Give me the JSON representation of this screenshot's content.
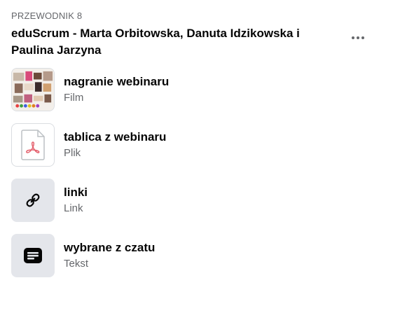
{
  "guide": {
    "label": "PRZEWODNIK 8",
    "title": "eduScrum - Marta Orbitowska, Danuta Idzikowska i Paulina Jarzyna"
  },
  "more_icon": "more-horizontal-icon",
  "items": [
    {
      "title": "nagranie webinaru",
      "type": "Film",
      "icon": "video-thumbnail"
    },
    {
      "title": "tablica z webinaru",
      "type": "Plik",
      "icon": "pdf-file-icon"
    },
    {
      "title": "linki",
      "type": "Link",
      "icon": "link-icon"
    },
    {
      "title": "wybrane z czatu",
      "type": "Tekst",
      "icon": "text-note-icon"
    }
  ],
  "colors": {
    "text_primary": "#050505",
    "text_secondary": "#65676b",
    "icon_bg": "#e4e6eb",
    "pdf_red": "#e4606d"
  }
}
